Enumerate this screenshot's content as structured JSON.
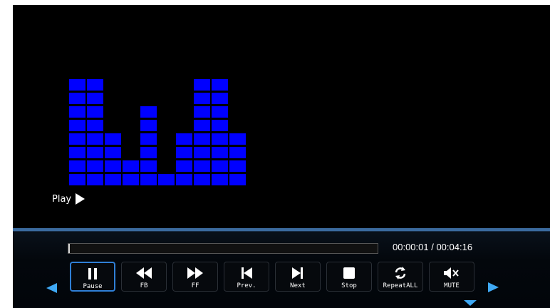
{
  "player": {
    "status_label": "Play",
    "time": "00:00:01 / 00:04:16",
    "progress_percent": 0.5
  },
  "visualizer": {
    "color": "#0000ff",
    "levels": [
      8,
      8,
      4,
      2,
      6,
      1,
      4,
      8,
      8,
      4
    ]
  },
  "controls": [
    {
      "label": "Pause",
      "icon": "pause-icon",
      "name": "pause-button",
      "active": true
    },
    {
      "label": "FB",
      "icon": "fast-backward-icon",
      "name": "fast-backward-button"
    },
    {
      "label": "FF",
      "icon": "fast-forward-icon",
      "name": "fast-forward-button"
    },
    {
      "label": "Prev.",
      "icon": "previous-icon",
      "name": "previous-button"
    },
    {
      "label": "Next",
      "icon": "next-icon",
      "name": "next-button"
    },
    {
      "label": "Stop",
      "icon": "stop-icon",
      "name": "stop-button"
    },
    {
      "label": "RepeatALL",
      "icon": "repeat-icon",
      "name": "repeat-all-button"
    },
    {
      "label": "MUTE",
      "icon": "mute-icon",
      "name": "mute-button"
    }
  ],
  "accent_color": "#3fa9f5"
}
